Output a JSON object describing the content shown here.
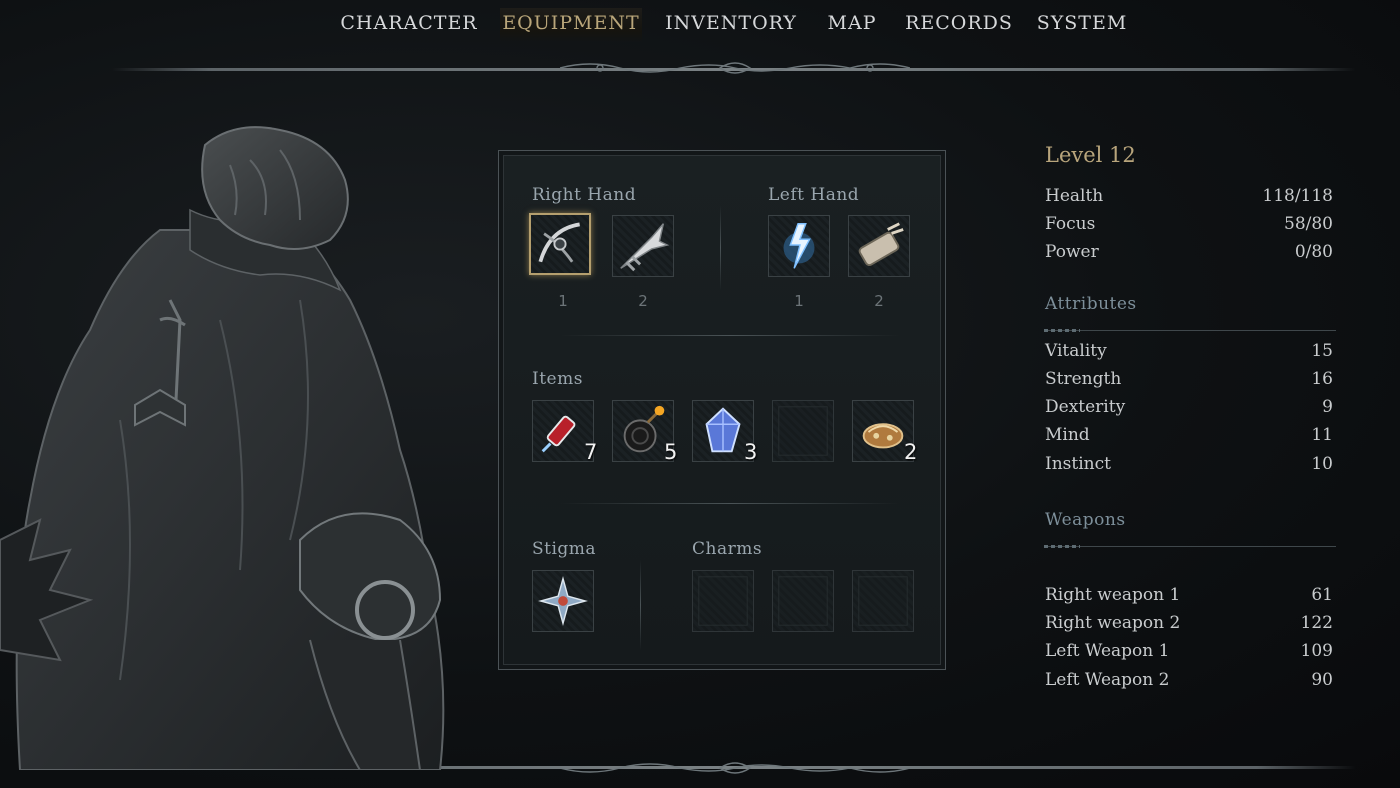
{
  "nav": {
    "tabs": [
      {
        "label": "CHARACTER"
      },
      {
        "label": "EQUIPMENT",
        "active": true
      },
      {
        "label": "INVENTORY"
      },
      {
        "label": "MAP"
      },
      {
        "label": "RECORDS"
      },
      {
        "label": "SYSTEM"
      }
    ]
  },
  "colors": {
    "accent_gold": "#b8a57c",
    "heading_blue": "#7d8f9a",
    "text": "#c9ccce",
    "background": "#0c0e10"
  },
  "equipment": {
    "right_hand": {
      "title": "Right Hand",
      "slots": [
        {
          "number": "1",
          "icon": "crossbow-weapon-icon",
          "selected": true
        },
        {
          "number": "2",
          "icon": "bone-claw-weapon-icon"
        }
      ]
    },
    "left_hand": {
      "title": "Left Hand",
      "slots": [
        {
          "number": "1",
          "icon": "lightning-spell-icon"
        },
        {
          "number": "2",
          "icon": "gauntlet-weapon-icon"
        }
      ]
    },
    "items": {
      "title": "Items",
      "slots": [
        {
          "icon": "red-vial-icon",
          "count": "7"
        },
        {
          "icon": "bomb-icon",
          "count": "5"
        },
        {
          "icon": "blue-crystal-icon",
          "count": "3"
        },
        {
          "icon": "empty-slot-icon",
          "count": ""
        },
        {
          "icon": "relic-bundle-icon",
          "count": "2"
        }
      ]
    },
    "stigma": {
      "title": "Stigma",
      "slots": [
        {
          "icon": "stigma-sigil-icon"
        }
      ]
    },
    "charms": {
      "title": "Charms",
      "slots": [
        {
          "icon": "empty-slot-icon"
        },
        {
          "icon": "empty-slot-icon"
        },
        {
          "icon": "empty-slot-icon"
        }
      ]
    }
  },
  "stats": {
    "level": "Level 12",
    "vitals": [
      {
        "label": "Health",
        "value": "118/118"
      },
      {
        "label": "Focus",
        "value": "58/80"
      },
      {
        "label": "Power",
        "value": "0/80"
      }
    ],
    "attributes_title": "Attributes",
    "attributes": [
      {
        "label": "Vitality",
        "value": "15"
      },
      {
        "label": "Strength",
        "value": "16"
      },
      {
        "label": "Dexterity",
        "value": "9"
      },
      {
        "label": "Mind",
        "value": "11"
      },
      {
        "label": "Instinct",
        "value": "10"
      }
    ],
    "weapons_title": "Weapons",
    "weapons": [
      {
        "label": "Right weapon 1",
        "value": "61"
      },
      {
        "label": "Right weapon 2",
        "value": "122"
      },
      {
        "label": "Left Weapon 1",
        "value": "109"
      },
      {
        "label": "Left Weapon 2",
        "value": "90"
      }
    ]
  }
}
